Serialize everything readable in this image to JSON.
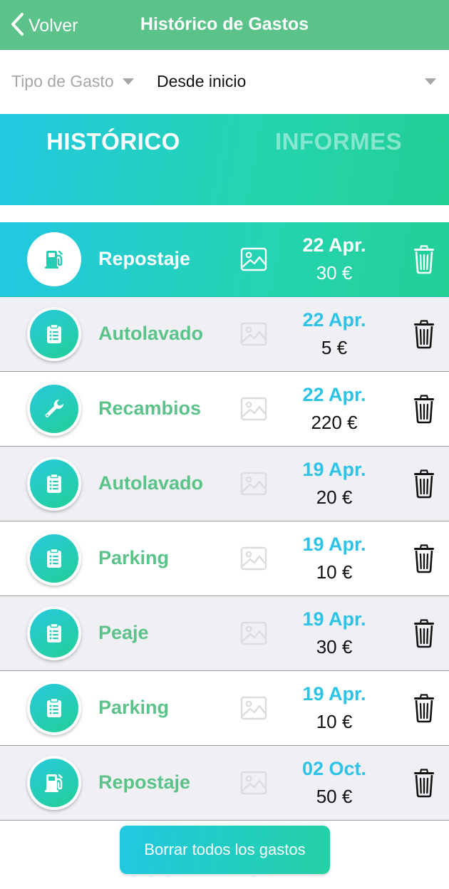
{
  "colors": {
    "nav_green": "#5bc28a",
    "accent_cyan": "#2ec3e6",
    "gradient_start": "#22c7e2",
    "gradient_end": "#22cf96"
  },
  "navbar": {
    "back_label": "Volver",
    "title": "Histórico de Gastos"
  },
  "filters": {
    "type_label": "Tipo de Gasto",
    "period_label": "Desde inicio"
  },
  "tabs": [
    {
      "label": "HISTÓRICO",
      "active": true
    },
    {
      "label": "INFORMES",
      "active": false
    }
  ],
  "expenses": [
    {
      "category": "Repostaje",
      "icon": "fuel-pump-icon",
      "date": "22 Apr.",
      "amount": "30 €",
      "selected": true
    },
    {
      "category": "Autolavado",
      "icon": "clipboard-list-icon",
      "date": "22 Apr.",
      "amount": "5 €"
    },
    {
      "category": "Recambios",
      "icon": "wrench-icon",
      "date": "22 Apr.",
      "amount": "220 €"
    },
    {
      "category": "Autolavado",
      "icon": "clipboard-list-icon",
      "date": "19 Apr.",
      "amount": "20 €"
    },
    {
      "category": "Parking",
      "icon": "clipboard-list-icon",
      "date": "19 Apr.",
      "amount": "10 €"
    },
    {
      "category": "Peaje",
      "icon": "clipboard-list-icon",
      "date": "19 Apr.",
      "amount": "30 €"
    },
    {
      "category": "Parking",
      "icon": "clipboard-list-icon",
      "date": "19 Apr.",
      "amount": "10 €"
    },
    {
      "category": "Repostaje",
      "icon": "fuel-pump-icon",
      "date": "02 Oct.",
      "amount": "50 €"
    }
  ],
  "footer": {
    "delete_all_label": "Borrar todos los gastos"
  }
}
